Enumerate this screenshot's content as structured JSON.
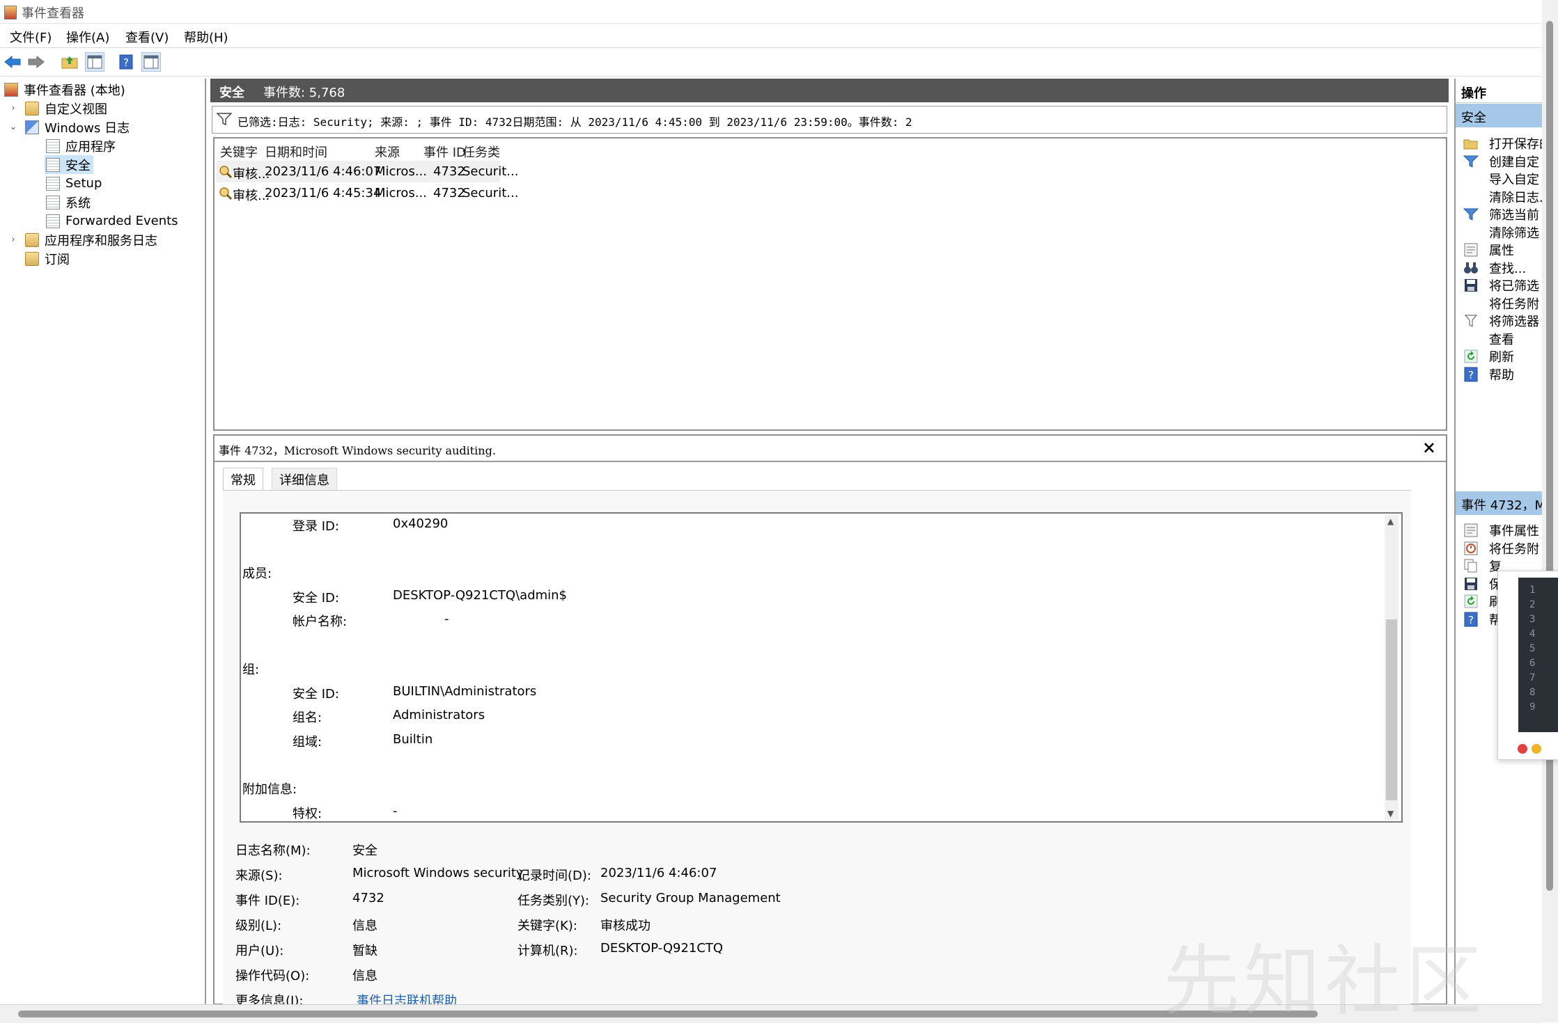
{
  "window": {
    "title": "事件查看器"
  },
  "menu": [
    {
      "label": "文件(F)"
    },
    {
      "label": "操作(A)"
    },
    {
      "label": "查看(V)"
    },
    {
      "label": "帮助(H)"
    }
  ],
  "toolbar": {
    "icons": [
      "back-arrow-icon",
      "forward-arrow-icon",
      "folder-up-icon",
      "show-hide-tree-icon",
      "help-icon",
      "show-hide-action-pane-icon"
    ]
  },
  "tree": {
    "root": "事件查看器 (本地)",
    "custom_views": "自定义视图",
    "windows_logs": "Windows 日志",
    "application": "应用程序",
    "security": "安全",
    "setup": "Setup",
    "system": "系统",
    "forwarded": "Forwarded Events",
    "app_service_logs": "应用程序和服务日志",
    "subscriptions": "订阅"
  },
  "center": {
    "log_name": "安全",
    "event_count": "事件数: 5,768",
    "filter_text": "已筛选:日志: Security; 来源: ; 事件 ID: 4732日期范围: 从 2023/11/6 4:45:00 到 2023/11/6 23:59:00。事件数: 2",
    "columns": {
      "keyword": "关键字",
      "datetime": "日期和时间",
      "source": "来源",
      "event_id": "事件 ID",
      "task": "任务类别"
    },
    "rows": [
      {
        "keyword": "审核...",
        "datetime": "2023/11/6 4:46:07",
        "source": "Micros...",
        "event_id": "4732",
        "task": "Securit..."
      },
      {
        "keyword": "审核...",
        "datetime": "2023/11/6 4:45:34",
        "source": "Micros...",
        "event_id": "4732",
        "task": "Securit..."
      }
    ]
  },
  "preview": {
    "title": "事件 4732，Microsoft Windows security auditing.",
    "tab_general": "常规",
    "tab_details": "详细信息",
    "detail": {
      "logon_id_label": "登录 ID:",
      "logon_id_value": "0x40290",
      "member_header": "成员:",
      "member_sid_label": "安全 ID:",
      "member_sid_value": "DESKTOP-Q921CTQ\\admin$",
      "account_name_label": "帐户名称:",
      "account_name_value": "-",
      "group_header": "组:",
      "group_sid_label": "安全 ID:",
      "group_sid_value": "BUILTIN\\Administrators",
      "group_name_label": "组名:",
      "group_name_value": "Administrators",
      "group_domain_label": "组域:",
      "group_domain_value": "Builtin",
      "extra_header": "附加信息:",
      "privilege_label": "特权:",
      "privilege_value": "-"
    },
    "props": {
      "log_name_label": "日志名称(M):",
      "log_name_value": "安全",
      "source_label": "来源(S):",
      "source_value": "Microsoft Windows security",
      "logged_label": "记录时间(D):",
      "logged_value": "2023/11/6 4:46:07",
      "event_id_label": "事件 ID(E):",
      "event_id_value": "4732",
      "task_label": "任务类别(Y):",
      "task_value": "Security Group Management",
      "level_label": "级别(L):",
      "level_value": "信息",
      "keywords_label": "关键字(K):",
      "keywords_value": "审核成功",
      "user_label": "用户(U):",
      "user_value": "暂缺",
      "computer_label": "计算机(R):",
      "computer_value": "DESKTOP-Q921CTQ",
      "opcode_label": "操作代码(O):",
      "opcode_value": "信息",
      "more_info_label": "更多信息(I):",
      "more_info_link": "事件日志联机帮助"
    }
  },
  "actions": {
    "header": "操作",
    "section1": "安全",
    "items1": [
      {
        "label": "打开保存的",
        "icon": "open-folder-icon"
      },
      {
        "label": "创建自定",
        "icon": "filter-icon"
      },
      {
        "label": "导入自定",
        "icon": ""
      },
      {
        "label": "清除日志...",
        "icon": ""
      },
      {
        "label": "筛选当前",
        "icon": "filter-icon"
      },
      {
        "label": "清除筛选",
        "icon": ""
      },
      {
        "label": "属性",
        "icon": "properties-icon"
      },
      {
        "label": "查找...",
        "icon": "binoculars-icon"
      },
      {
        "label": "将已筛选",
        "icon": "save-icon"
      },
      {
        "label": "将任务附",
        "icon": ""
      },
      {
        "label": "将筛选器",
        "icon": "filter-attach-icon"
      },
      {
        "label": "查看",
        "icon": ""
      },
      {
        "label": "刷新",
        "icon": "refresh-icon"
      },
      {
        "label": "帮助",
        "icon": "help-icon"
      }
    ],
    "section2": "事件 4732，M",
    "items2": [
      {
        "label": "事件属性",
        "icon": "properties-icon"
      },
      {
        "label": "将任务附",
        "icon": "task-icon"
      },
      {
        "label": "复",
        "icon": "copy-icon"
      },
      {
        "label": "保",
        "icon": "save-icon"
      },
      {
        "label": "刷",
        "icon": "refresh-icon"
      },
      {
        "label": "帮",
        "icon": "help-icon"
      }
    ]
  },
  "overlay": {
    "line_numbers": [
      "1",
      "2",
      "3",
      "4",
      "5",
      "6",
      "7",
      "8",
      "9"
    ]
  },
  "watermark": "先知社区"
}
